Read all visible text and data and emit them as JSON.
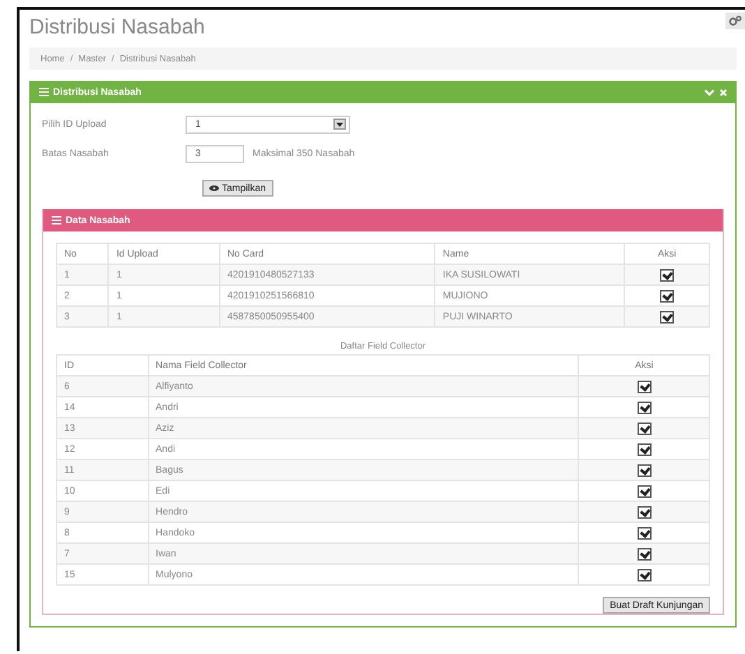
{
  "page": {
    "title": "Distribusi Nasabah"
  },
  "breadcrumb": {
    "items": [
      "Home",
      "Master",
      "Distribusi Nasabah"
    ],
    "separator": "/"
  },
  "main_panel": {
    "title": "Distribusi Nasabah",
    "upload_field": {
      "label": "Pilih ID Upload",
      "value": "1"
    },
    "limit_field": {
      "label": "Batas Nasabah",
      "value": "3",
      "hint": "Maksimal 350 Nasabah"
    },
    "show_button": "Tampilkan"
  },
  "data_panel": {
    "title": "Data Nasabah",
    "customers": {
      "columns": [
        "No",
        "Id Upload",
        "No Card",
        "Name",
        "Aksi"
      ],
      "rows": [
        {
          "cells": [
            "1",
            "1",
            "4201910480527133",
            "IKA SUSILOWATI"
          ],
          "checked": true
        },
        {
          "cells": [
            "2",
            "1",
            "4201910251566810",
            "MUJIONO"
          ],
          "checked": true
        },
        {
          "cells": [
            "3",
            "1",
            "4587850050955400",
            "PUJI WINARTO"
          ],
          "checked": true
        }
      ]
    },
    "collectors": {
      "caption": "Daftar Field Collector",
      "columns": [
        "ID",
        "Nama Field Collector",
        "Aksi"
      ],
      "rows": [
        {
          "cells": [
            "6",
            "Alfiyanto"
          ],
          "checked": true
        },
        {
          "cells": [
            "14",
            "Andri"
          ],
          "checked": true
        },
        {
          "cells": [
            "13",
            "Aziz"
          ],
          "checked": true
        },
        {
          "cells": [
            "12",
            "Andi"
          ],
          "checked": true
        },
        {
          "cells": [
            "11",
            "Bagus"
          ],
          "checked": true
        },
        {
          "cells": [
            "10",
            "Edi"
          ],
          "checked": true
        },
        {
          "cells": [
            "9",
            "Hendro"
          ],
          "checked": true
        },
        {
          "cells": [
            "8",
            "Handoko"
          ],
          "checked": true
        },
        {
          "cells": [
            "7",
            "Iwan"
          ],
          "checked": true
        },
        {
          "cells": [
            "15",
            "Mulyono"
          ],
          "checked": true
        }
      ]
    },
    "submit_button": "Buat Draft Kunjungan"
  }
}
